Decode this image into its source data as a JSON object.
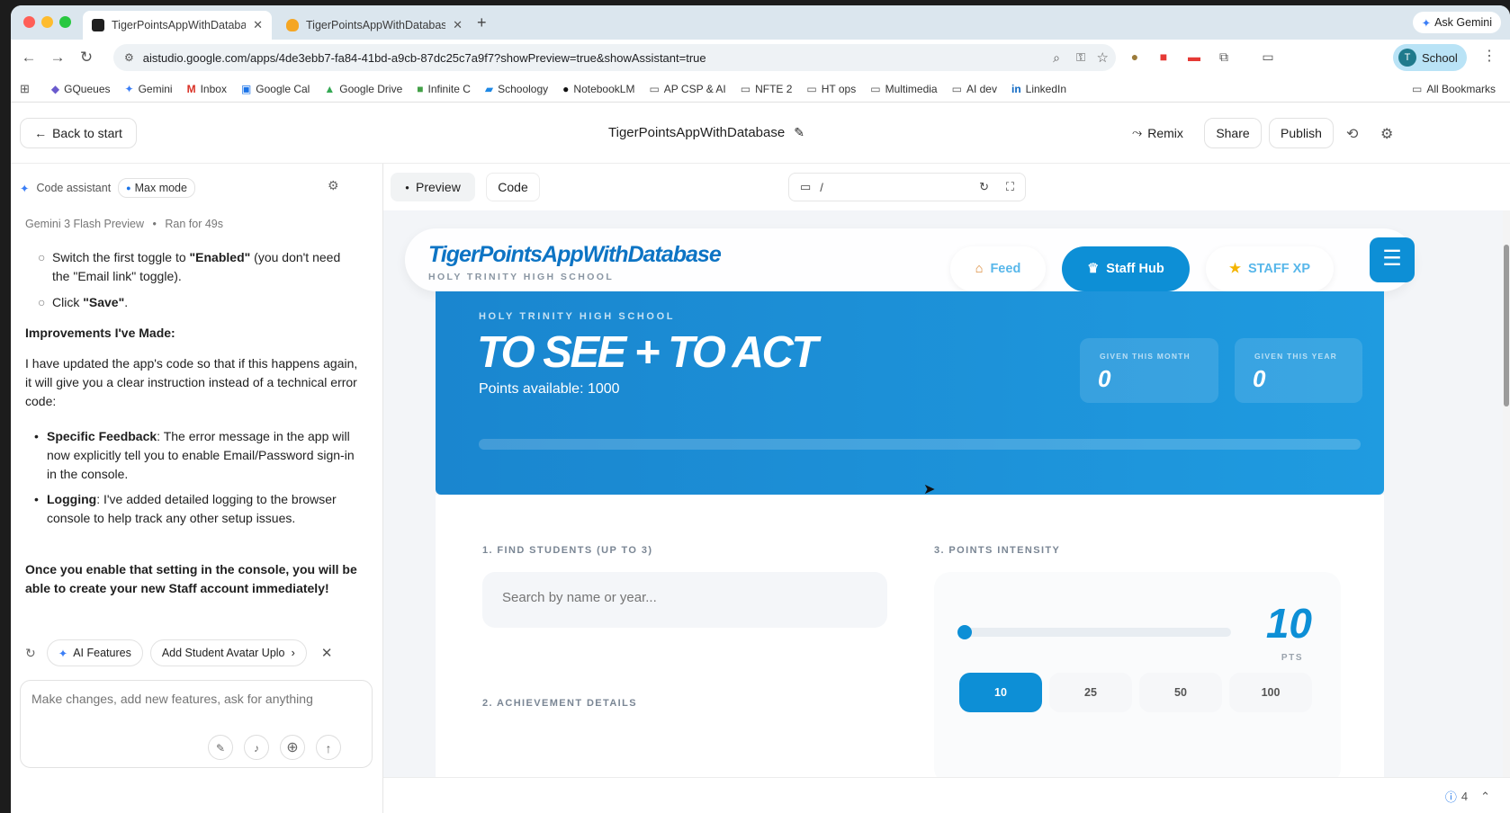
{
  "browser": {
    "tabs": [
      {
        "title": "TigerPointsAppWithDatabase"
      },
      {
        "title": "TigerPointsAppWithDatabase"
      }
    ],
    "new_tab": "+",
    "ask_gemini": "Ask Gemini",
    "url": "aistudio.google.com/apps/4de3ebb7-fa84-41bd-a9cb-87dc25c7a9f7?showPreview=true&showAssistant=true",
    "profile": {
      "initial": "T",
      "label": "School"
    },
    "bookmarks": [
      "GQueues",
      "Gemini",
      "Inbox",
      "Google Cal",
      "Google Drive",
      "Infinite C",
      "Schoology",
      "NotebookLM",
      "AP CSP & AI",
      "NFTE 2",
      "HT ops",
      "Multimedia",
      "AI dev",
      "LinkedIn"
    ],
    "all_bookmarks": "All Bookmarks"
  },
  "studio": {
    "back": "Back to start",
    "project_title": "TigerPointsAppWithDatabase",
    "remix": "Remix",
    "share": "Share",
    "publish": "Publish",
    "assistant_label": "Code assistant",
    "max_mode": "Max mode",
    "model_line": "Gemini 3 Flash Preview",
    "ran_for": "Ran for 49s",
    "tab_preview": "Preview",
    "tab_code": "Code",
    "path": "/",
    "suggestions": [
      "AI Features",
      "Add Student Avatar Uplo"
    ],
    "prompt_placeholder": "Make changes, add new features, ask for anything",
    "issues_count": "4"
  },
  "chat": {
    "bullet1_pre": "Switch the first toggle to ",
    "bullet1_bold": "\"Enabled\"",
    "bullet1_post": " (you don't need the \"Email link\" toggle).",
    "bullet2_pre": "Click ",
    "bullet2_bold": "\"Save\"",
    "bullet2_post": ".",
    "improvements_heading": "Improvements I've Made:",
    "paragraph": "I have updated the app's code so that if this happens again, it will give you a clear instruction instead of a technical error code:",
    "item1_bold": "Specific Feedback",
    "item1_text": ": The error message in the app will now explicitly tell you to enable Email/Password sign-in in the console.",
    "item2_bold": "Logging",
    "item2_text": ": I've added detailed logging to the browser console to help track any other setup issues.",
    "closing": "Once you enable that setting in the console, you will be able to create your new Staff account immediately!"
  },
  "app": {
    "title": "TigerPointsAppWithDatabase",
    "school": "HOLY TRINITY HIGH SCHOOL",
    "nav": {
      "feed": "Feed",
      "staff_hub": "Staff Hub",
      "staff_xp": "STAFF XP"
    },
    "hero": {
      "school": "HOLY TRINITY HIGH SCHOOL",
      "headline": "TO SEE + TO ACT",
      "points_available": "Points available: 1000"
    },
    "stats": [
      {
        "label": "GIVEN THIS MONTH",
        "value": "0"
      },
      {
        "label": "GIVEN THIS YEAR",
        "value": "0"
      }
    ],
    "find_label": "1. FIND STUDENTS (UP TO 3)",
    "search_placeholder": "Search by name or year...",
    "achievement_label": "2. ACHIEVEMENT DETAILS",
    "intensity_label": "3. POINTS INTENSITY",
    "points_value": "10",
    "points_unit": "PTS",
    "slider_level": 0.0,
    "presets": [
      "10",
      "25",
      "50",
      "100"
    ],
    "accent": "#0d8fd6"
  }
}
